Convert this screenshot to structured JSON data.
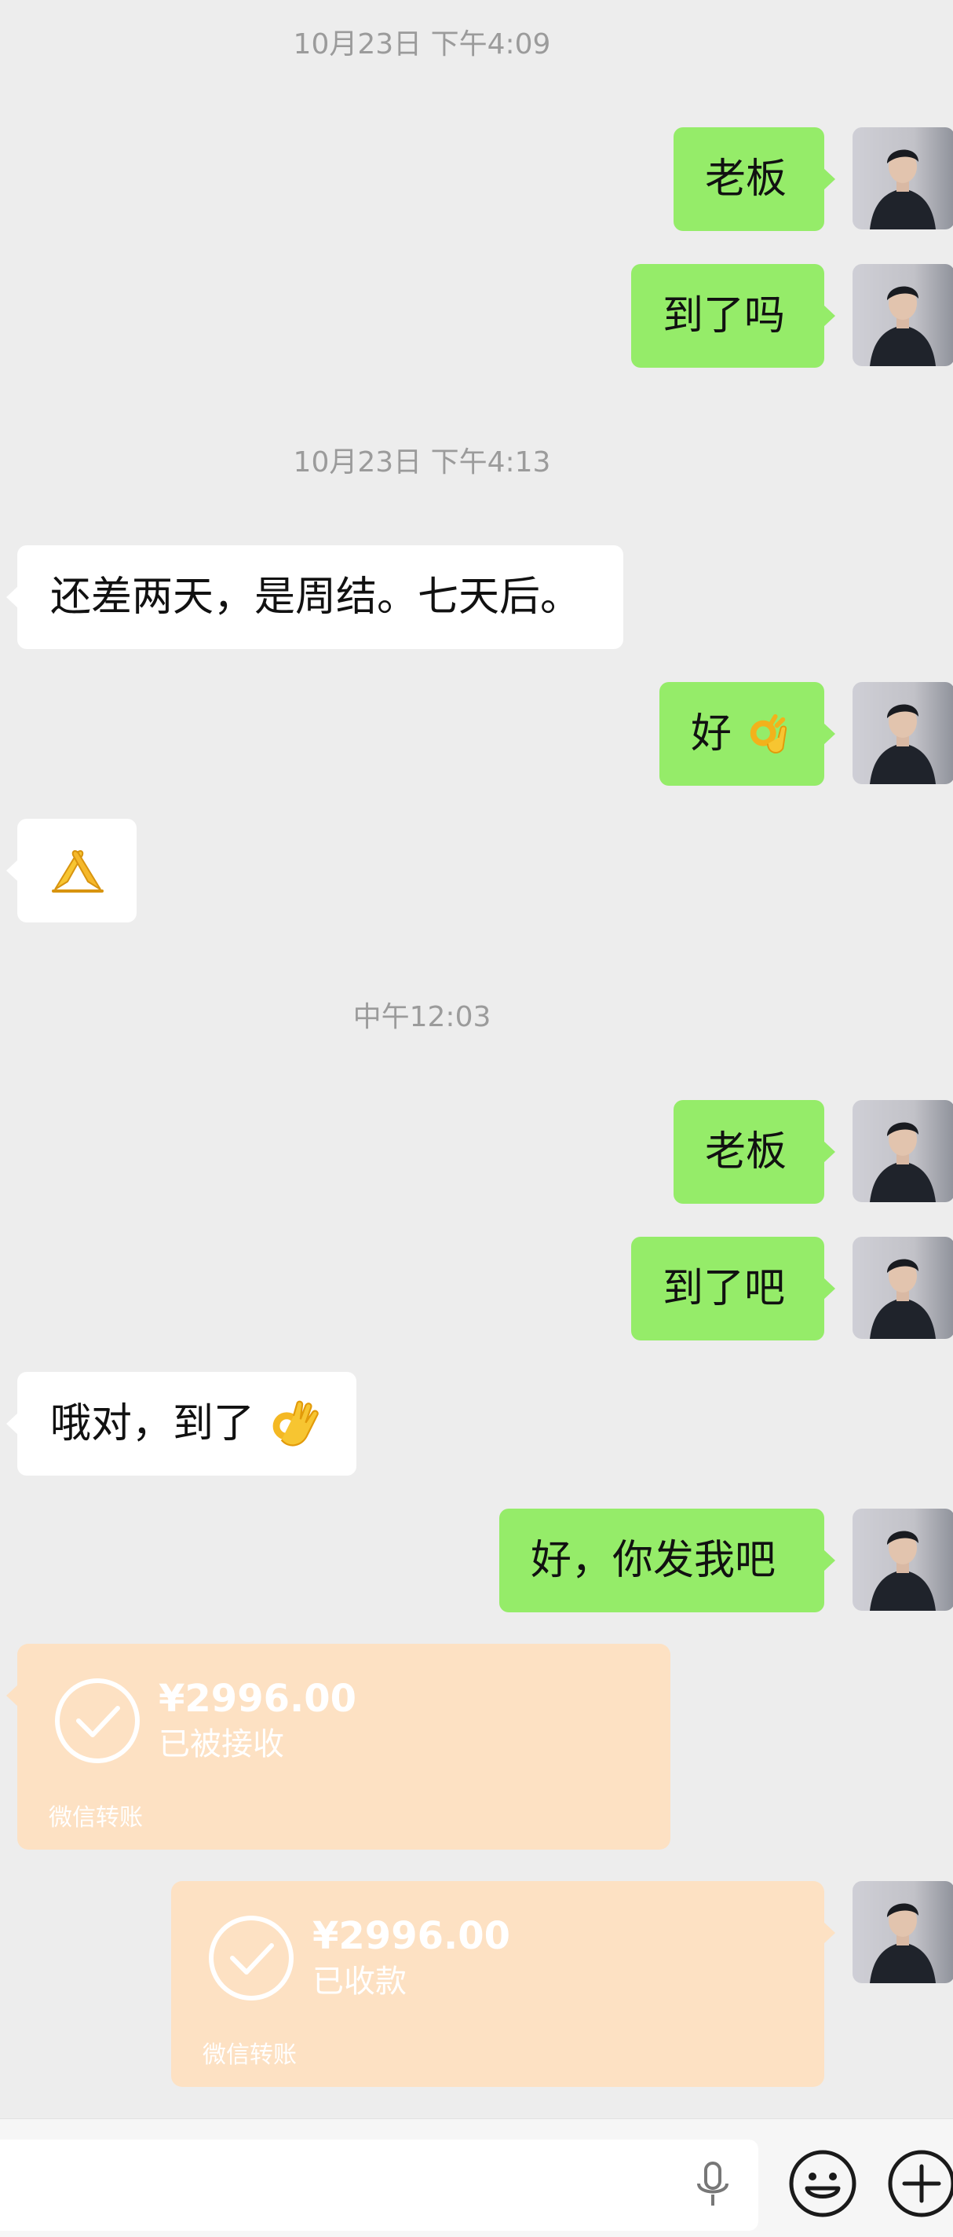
{
  "timestamps": {
    "t1": "10月23日 下午4:09",
    "t2": "10月23日 下午4:13",
    "t3": "中午12:03"
  },
  "messages": [
    {
      "side": "out",
      "text": "老板"
    },
    {
      "side": "out",
      "text": "到了吗"
    },
    {
      "side": "in",
      "text": "还差两天，是周结。七天后。"
    },
    {
      "side": "out",
      "text": "好",
      "emoji": "ok-hand-emoji"
    },
    {
      "side": "in",
      "emoji": "folded-hands-emoji"
    },
    {
      "side": "out",
      "text": "老板"
    },
    {
      "side": "out",
      "text": "到了吧"
    },
    {
      "side": "in",
      "text": "哦对，到了",
      "emoji": "ok-hand-emoji"
    },
    {
      "side": "out",
      "text": "好，你发我吧"
    }
  ],
  "transfers": {
    "received": {
      "amount": "¥2996.00",
      "status": "已被接收",
      "label": "微信转账"
    },
    "sent_confirmed": {
      "amount": "¥2996.00",
      "status": "已收款",
      "label": "微信转账"
    }
  },
  "input_bar": {
    "icons": [
      "microphone-icon",
      "emoji-icon",
      "plus-icon"
    ]
  },
  "colors": {
    "background": "#ededed",
    "outgoing_bubble": "#95ec69",
    "incoming_bubble": "#ffffff",
    "transfer_card": "#fde1c3"
  }
}
